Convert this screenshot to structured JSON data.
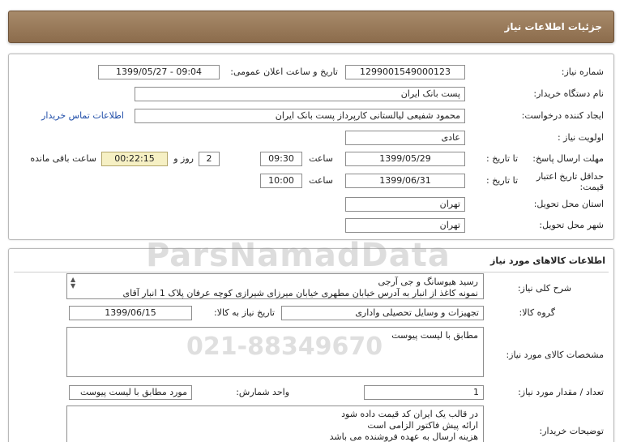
{
  "page_title": "جزئیات اطلاعات نیاز",
  "info": {
    "need_number_label": "شماره نیاز:",
    "need_number": "1299001549000123",
    "announce_label": "تاریخ و ساعت اعلان عمومی:",
    "announce_value": "1399/05/27 - 09:04",
    "buyer_org_label": "نام دستگاه خریدار:",
    "buyer_org": "پست بانک ایران",
    "requester_label": "ایجاد کننده درخواست:",
    "requester": "محمود شفیعی لیالستانی کارپرداز پست بانک ایران",
    "contact_link": "اطلاعات تماس خریدار",
    "priority_label": "اولویت نیاز :",
    "priority": "عادی",
    "deadline_label": "مهلت ارسال پاسخ:",
    "to_date_label": "تا تاریخ :",
    "deadline_date": "1399/05/29",
    "time_label": "ساعت",
    "deadline_time": "09:30",
    "days_value": "2",
    "days_label": "روز و",
    "remaining_time": "00:22:15",
    "remaining_label": "ساعت باقی مانده",
    "validity_label": "حداقل تاریخ اعتبار قیمت:",
    "validity_to_label": "تا تاریخ :",
    "validity_date": "1399/06/31",
    "validity_time_label": "ساعت",
    "validity_time": "10:00",
    "province_label": "استان محل تحویل:",
    "province": "تهران",
    "city_label": "شهر محل تحویل:",
    "city": "تهران"
  },
  "goods": {
    "section_title": "اطلاعات کالاهای مورد نیاز",
    "summary_label": "شرح کلی نیاز:",
    "summary_line1": "رسید هیوسانگ و جی آرجی",
    "summary_line2": "نمونه کاغذ از انبار به آدرس خیابان مطهری خیابان میرزای شیرازی کوچه عرفان پلاک 1 انبار آقای",
    "group_label": "گروه کالا:",
    "group_value": "تجهیزات و وسایل تحصیلی واداری",
    "need_date_label": "تاریخ نیاز به کالا:",
    "need_date": "1399/06/15",
    "specs_label": "مشخصات کالای مورد نیاز:",
    "specs_value": "مطابق با لیست پیوست",
    "qty_label": "تعداد / مقدار مورد نیاز:",
    "qty_value": "1",
    "unit_label": "واحد شمارش:",
    "unit_value": "مورد مطابق با لیست پیوست",
    "buyer_notes_label": "توضیحات خریدار:",
    "buyer_notes": [
      "در قالب یک ایران کد قیمت داده شود",
      "ارائه پیش فاکتور الزامی است",
      "هزینه ارسال به عهده فروشنده می باشد"
    ]
  },
  "watermark": {
    "brand": "ParsNamadData",
    "phone": "021-88349670"
  }
}
